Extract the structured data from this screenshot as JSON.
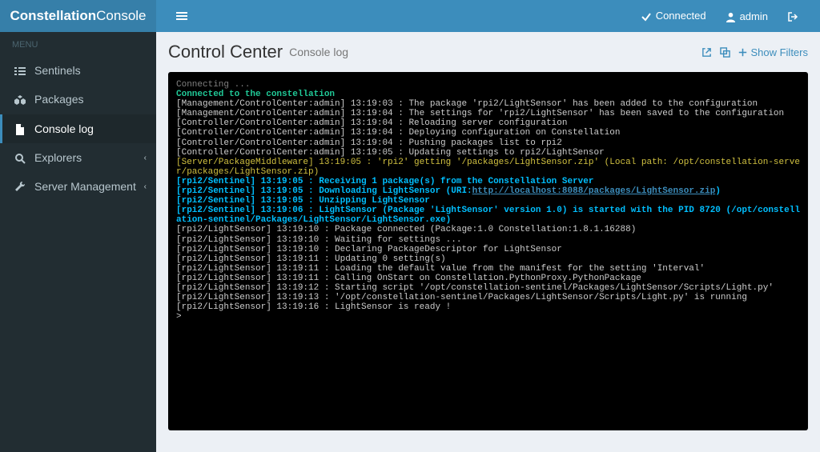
{
  "brand": {
    "bold": "Constellation",
    "light": "Console"
  },
  "header": {
    "connected": "Connected",
    "user": "admin"
  },
  "sidebar": {
    "menu_label": "MENU",
    "items": [
      {
        "label": "Sentinels",
        "icon": "list",
        "caret": false
      },
      {
        "label": "Packages",
        "icon": "cubes",
        "caret": false
      },
      {
        "label": "Console log",
        "icon": "file",
        "caret": false,
        "active": true
      },
      {
        "label": "Explorers",
        "icon": "search",
        "caret": true
      },
      {
        "label": "Server Management",
        "icon": "wrench",
        "caret": true
      }
    ]
  },
  "page": {
    "title": "Control Center",
    "subtitle": "Console log",
    "actions": {
      "show_filters": "Show Filters"
    }
  },
  "console": {
    "lines": [
      {
        "cls": "gray",
        "text": "Connecting ..."
      },
      {
        "cls": "green",
        "text": "Connected to the constellation"
      },
      {
        "cls": "white",
        "text": "[Management/ControlCenter:admin] 13:19:03 : The package 'rpi2/LightSensor' has been added to the configuration"
      },
      {
        "cls": "white",
        "text": "[Management/ControlCenter:admin] 13:19:04 : The settings for 'rpi2/LightSensor' has been saved to the configuration"
      },
      {
        "cls": "white",
        "text": "[Controller/ControlCenter:admin] 13:19:04 : Reloading server configuration"
      },
      {
        "cls": "white",
        "text": "[Controller/ControlCenter:admin] 13:19:04 : Deploying configuration on Constellation"
      },
      {
        "cls": "white",
        "text": "[Controller/ControlCenter:admin] 13:19:04 : Pushing packages list to rpi2"
      },
      {
        "cls": "white",
        "text": "[Controller/ControlCenter:admin] 13:19:05 : Updating settings to rpi2/LightSensor"
      },
      {
        "cls": "yellow",
        "text": "[Server/PackageMiddleware] 13:19:05 : 'rpi2' getting '/packages/LightSensor.zip' (Local path: /opt/constellation-server/packages/LightSensor.zip)"
      },
      {
        "cls": "cyan",
        "text": "[rpi2/Sentinel] 13:19:05 : Receiving 1 package(s) from the Constellation Server"
      },
      {
        "cls": "cyan",
        "text": "[rpi2/Sentinel] 13:19:05 : Downloading LightSensor (URI:",
        "link": "http://localhost:8088/packages/LightSensor.zip",
        "tail": ")"
      },
      {
        "cls": "cyan",
        "text": "[rpi2/Sentinel] 13:19:05 : Unzipping LightSensor"
      },
      {
        "cls": "cyan",
        "text": "[rpi2/Sentinel] 13:19:06 : LightSensor (Package 'LightSensor' version 1.0) is started with the PID 8720 (/opt/constellation-sentinel/Packages/LightSensor/LightSensor.exe)"
      },
      {
        "cls": "white",
        "text": "[rpi2/LightSensor] 13:19:10 : Package connected (Package:1.0 Constellation:1.8.1.16288)"
      },
      {
        "cls": "white",
        "text": "[rpi2/LightSensor] 13:19:10 : Waiting for settings ..."
      },
      {
        "cls": "white",
        "text": "[rpi2/LightSensor] 13:19:10 : Declaring PackageDescriptor for LightSensor"
      },
      {
        "cls": "white",
        "text": "[rpi2/LightSensor] 13:19:11 : Updating 0 setting(s)"
      },
      {
        "cls": "white",
        "text": "[rpi2/LightSensor] 13:19:11 : Loading the default value from the manifest for the setting 'Interval'"
      },
      {
        "cls": "white",
        "text": "[rpi2/LightSensor] 13:19:11 : Calling OnStart on Constellation.PythonProxy.PythonPackage"
      },
      {
        "cls": "white",
        "text": "[rpi2/LightSensor] 13:19:12 : Starting script '/opt/constellation-sentinel/Packages/LightSensor/Scripts/Light.py'"
      },
      {
        "cls": "white",
        "text": "[rpi2/LightSensor] 13:19:13 : '/opt/constellation-sentinel/Packages/LightSensor/Scripts/Light.py' is running"
      },
      {
        "cls": "white",
        "text": "[rpi2/LightSensor] 13:19:16 : LightSensor is ready !"
      },
      {
        "cls": "white",
        "text": ">"
      }
    ]
  }
}
